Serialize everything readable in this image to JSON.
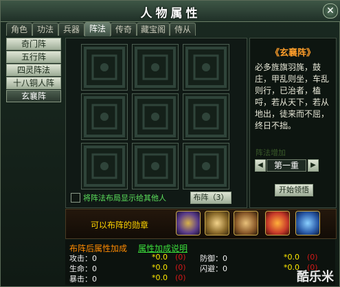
{
  "window": {
    "title": "人物属性",
    "close_label": "✕"
  },
  "tabs": [
    {
      "label": "角色"
    },
    {
      "label": "功法"
    },
    {
      "label": "兵器"
    },
    {
      "label": "阵法"
    },
    {
      "label": "传奇"
    },
    {
      "label": "藏宝阁"
    },
    {
      "label": "侍从"
    }
  ],
  "formations": [
    {
      "label": "奇门阵"
    },
    {
      "label": "五行阵"
    },
    {
      "label": "四灵阵法"
    },
    {
      "label": "十八铜人阵"
    },
    {
      "label": "玄襄阵"
    }
  ],
  "grid": {
    "hint": "将阵法布局显示给其他人",
    "deploy_button": "布阵（3）"
  },
  "info": {
    "name": "《玄襄阵》",
    "description": "必多旌旗羽旄，鼓庄，甲乱则坐，车乱则行，已治者，榼哷，若从天下，若从地出，徒来而不屈，终日不拙。",
    "faded_text": "阵法增加",
    "level": "第一重",
    "prev_label": "◀",
    "next_label": "▶",
    "start_button": "开始领悟"
  },
  "badges": {
    "label": "可以布阵的勋章"
  },
  "stats": {
    "header": "布阵后属性加成",
    "link": "属性加成说明",
    "attack_label": "攻击：0",
    "attack_mult": "*0.0",
    "attack_extra": "(0)",
    "life_label": "生命：0",
    "life_mult": "*0.0",
    "life_extra": "(0)",
    "crit_label": "暴击：0",
    "crit_mult": "*0.0",
    "crit_extra": "(0)",
    "defense_label": "防御：0",
    "defense_mult": "*0.0",
    "defense_extra": "(0)",
    "dodge_label": "闪避：0",
    "dodge_mult": "*0.0",
    "dodge_extra": "(0)"
  },
  "watermark": "酷乐米"
}
